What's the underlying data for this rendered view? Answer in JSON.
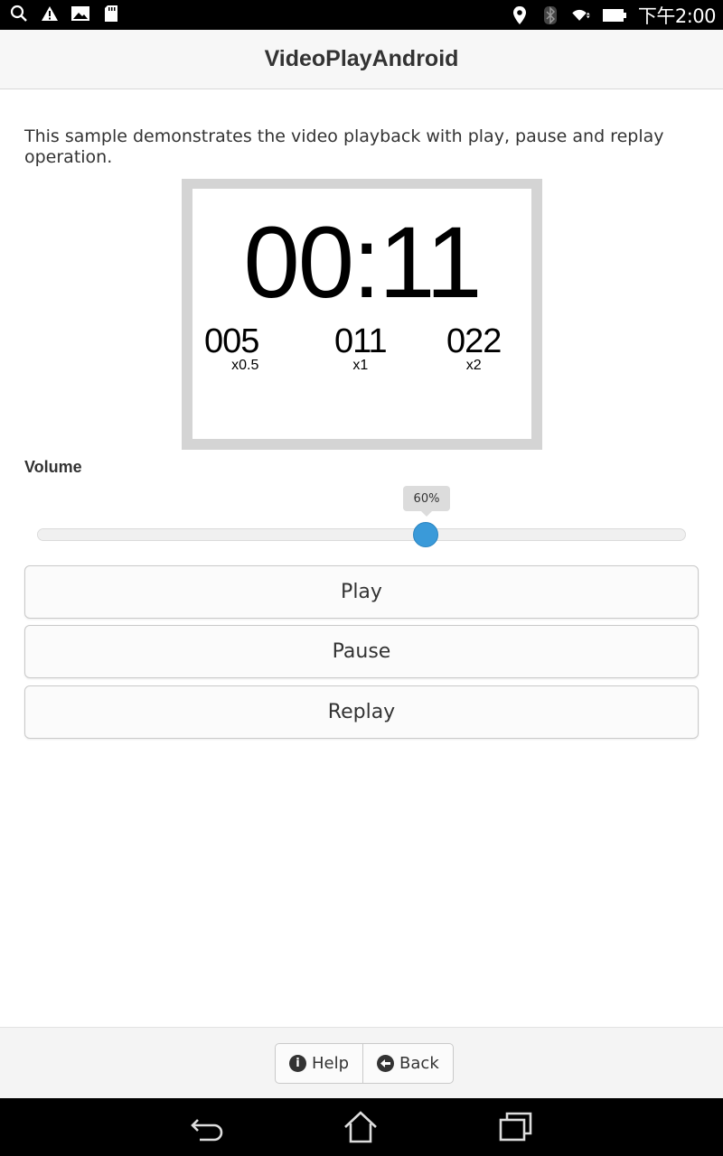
{
  "status_bar": {
    "time": "下午2:00",
    "left_icons": [
      "search-icon",
      "warning-icon",
      "image-icon",
      "sd-card-icon"
    ],
    "right_icons": [
      "location-icon",
      "bluetooth-icon",
      "wifi-icon",
      "battery-icon"
    ]
  },
  "header": {
    "title": "VideoPlayAndroid"
  },
  "description": "This sample demonstrates the video playback with play, pause and replay operation.",
  "video": {
    "timer": "00:11",
    "speeds": [
      {
        "value": "005",
        "multiplier": "x0.5"
      },
      {
        "value": "011",
        "multiplier": "x1"
      },
      {
        "value": "022",
        "multiplier": "x2"
      }
    ]
  },
  "volume": {
    "label": "Volume",
    "value_text": "60%",
    "level": 0.6,
    "accent": "#3a9ad9"
  },
  "buttons": {
    "play": "Play",
    "pause": "Pause",
    "replay": "Replay"
  },
  "footer": {
    "help": "Help",
    "back": "Back"
  },
  "navbar": {
    "icons": [
      "back-nav-icon",
      "home-nav-icon",
      "recents-nav-icon"
    ]
  }
}
